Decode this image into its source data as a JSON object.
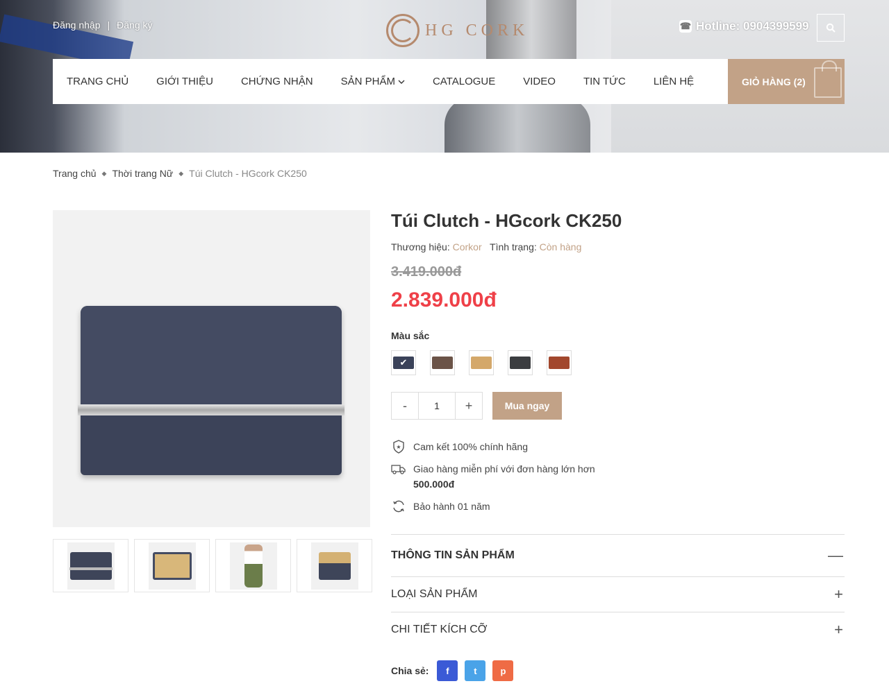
{
  "header": {
    "login": "Đăng nhập",
    "separator": "|",
    "register": "Đăng ký",
    "logo_text": "HG CORK",
    "hotline": "Hotline: 0904399599"
  },
  "nav": {
    "items": [
      "TRANG CHỦ",
      "GIỚI THIỆU",
      "CHỨNG NHẬN",
      "SẢN PHẨM",
      "CATALOGUE",
      "VIDEO",
      "TIN TỨC",
      "LIÊN HỆ"
    ],
    "cart": "GIỎ HÀNG (2)"
  },
  "breadcrumb": {
    "home": "Trang chủ",
    "category": "Thời trang Nữ",
    "current": "Túi Clutch - HGcork CK250"
  },
  "product": {
    "title": "Túi Clutch - HGcork CK250",
    "brand_label": "Thương hiệu:",
    "brand": "Corkor",
    "status_label": "Tình trạng:",
    "status": "Còn hàng",
    "old_price": "3.419.000đ",
    "price": "2.839.000đ",
    "color_label": "Màu sắc",
    "colors": [
      "#3a4259",
      "#6b5347",
      "#d4a86a",
      "#3b3d40",
      "#a2472d"
    ],
    "selected_color_index": 0,
    "quantity": "1",
    "minus": "-",
    "plus": "+",
    "buy": "Mua ngay"
  },
  "features": {
    "genuine": "Cam kết 100% chính hãng",
    "shipping": "Giao hàng miễn phí với đơn hàng lớn hơn",
    "shipping_amount": "500.000đ",
    "warranty": "Bảo hành 01 năm"
  },
  "accordion": {
    "info": "THÔNG TIN SẢN PHẨM",
    "type": "LOẠI SẢN PHẨM",
    "size": "CHI TIẾT KÍCH CỠ",
    "collapse_sign": "—",
    "expand_sign": "+"
  },
  "share": {
    "label": "Chia sẻ:",
    "facebook": "f",
    "twitter": "t",
    "pinterest": "p"
  },
  "colors": {
    "accent": "#c2a287",
    "price": "#ef4048",
    "facebook": "#3b5ad6",
    "twitter": "#4aa3e8",
    "pinterest": "#ef6b45"
  }
}
